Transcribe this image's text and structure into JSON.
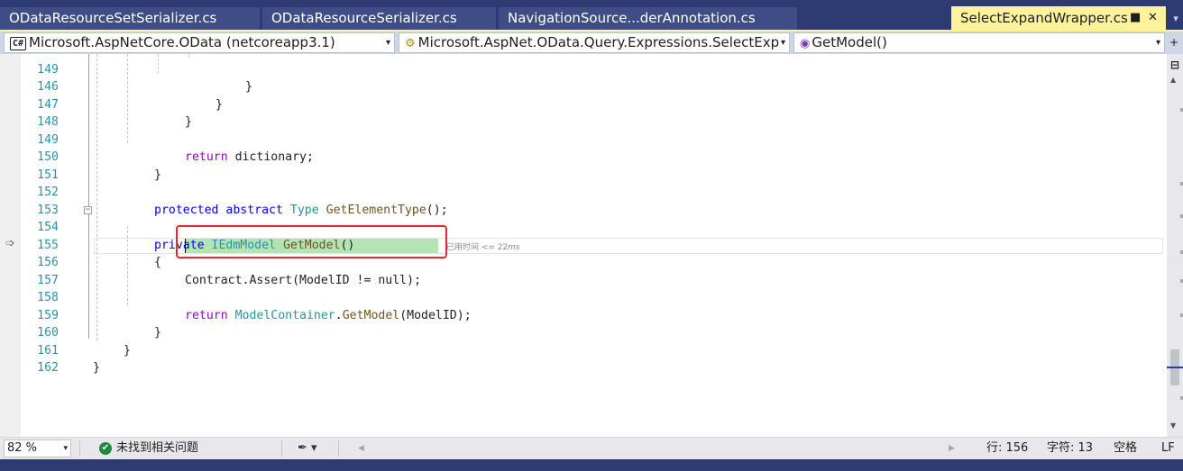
{
  "tabs": [
    {
      "label": "ODataResourceSetSerializer.cs",
      "active": false
    },
    {
      "label": "ODataResourceSerializer.cs",
      "active": false
    },
    {
      "label": "NavigationSource...derAnnotation.cs",
      "active": false
    },
    {
      "label": "SelectExpandWrapper.cs",
      "active": true
    }
  ],
  "tab_icons": {
    "pin": "pin-icon",
    "close": "close-icon",
    "pin_glyph": "■",
    "close_glyph": "✕",
    "overflow_glyph": "▾"
  },
  "navbar": {
    "project": "Microsoft.AspNetCore.OData (netcoreapp3.1)",
    "project_badge": "C#",
    "type": "Microsoft.AspNet.OData.Query.Expressions.SelectExp",
    "member": "GetModel()",
    "dropdown_glyph": "▾"
  },
  "editor": {
    "line_numbers": [
      "149",
      "146",
      "147",
      "148",
      "149",
      "150",
      "151",
      "152",
      "153",
      "154",
      "155",
      "156",
      "157",
      "158",
      "159",
      "160",
      "161",
      "162"
    ],
    "lines": {
      "l145": "}",
      "l146": "}",
      "l147": "}",
      "l149_kw": "return",
      "l149_rest": " dictionary;",
      "l150": "}",
      "l152_kw1": "protected",
      "l152_kw2": "abstract",
      "l152_type": "Type",
      "l152_method": "GetElementType",
      "l152_rest": "();",
      "l154_kw": "private",
      "l154_type": "IEdmModel",
      "l154_method": "GetModel",
      "l154_rest": "()",
      "l155": "{",
      "l156": "Contract.Assert(ModelID != null);",
      "l158_kw": "return",
      "l158_type": "ModelContainer",
      "l158_dot": ".",
      "l158_method": "GetModel",
      "l158_rest": "(ModelID);",
      "l159": "}",
      "l160": "}",
      "l161": "}"
    },
    "perf_tip": "已用时间 <= 22ms",
    "fold_glyph": "−",
    "ip_glyph": "➩"
  },
  "statusbar": {
    "zoom": "82 %",
    "issues": "未找到相关问题",
    "line": "行: 156",
    "char": "字符: 13",
    "spaces": "空格",
    "eol": "LF",
    "ok_glyph": "✔",
    "brush_glyph": "✒ ▾",
    "left_glyph": "◀",
    "right_glyph": "▶"
  },
  "colors": {
    "tab_strip": "#2e3b73",
    "active_tab": "#fff29d",
    "keyword": "#0000ff",
    "type": "#2b91af",
    "method": "#74531f",
    "statement_highlight": "#b4e4b4",
    "annotation_box": "#e8282e"
  }
}
